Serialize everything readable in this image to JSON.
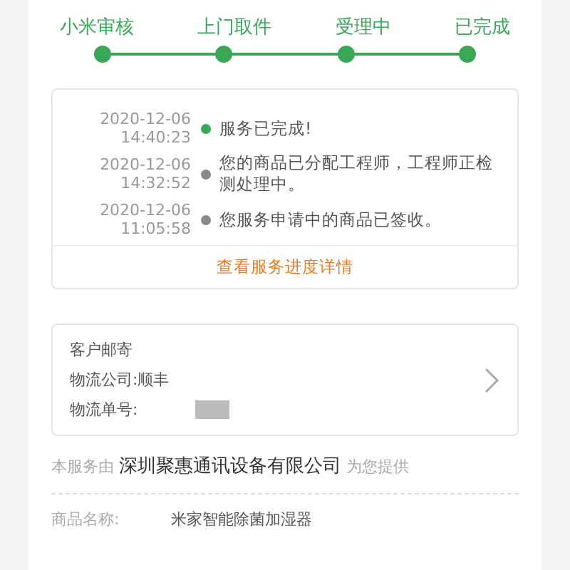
{
  "steps": [
    {
      "label": "小米审核",
      "done": true
    },
    {
      "label": "上门取件",
      "done": true
    },
    {
      "label": "受理中",
      "done": true
    },
    {
      "label": "已完成",
      "done": true
    }
  ],
  "timeline": {
    "entries": [
      {
        "date": "2020-12-06",
        "time": "14:40:23",
        "text": "服务已完成!",
        "current": true
      },
      {
        "date": "2020-12-06",
        "time": "14:32:52",
        "text": "您的商品已分配工程师，工程师正检测处理中。",
        "current": false
      },
      {
        "date": "2020-12-06",
        "time": "11:05:58",
        "text": "您服务申请中的商品已签收。",
        "current": false
      }
    ],
    "link": "查看服务进度详情"
  },
  "shipping": {
    "title": "客户邮寄",
    "company_label": "物流公司:",
    "company": "顺丰",
    "number_label": "物流单号:"
  },
  "provider": {
    "prefix": "本服务由",
    "company": "深圳聚惠通讯设备有限公司",
    "suffix": "为您提供"
  },
  "product": {
    "label": "商品名称:",
    "value": "米家智能除菌加湿器"
  }
}
